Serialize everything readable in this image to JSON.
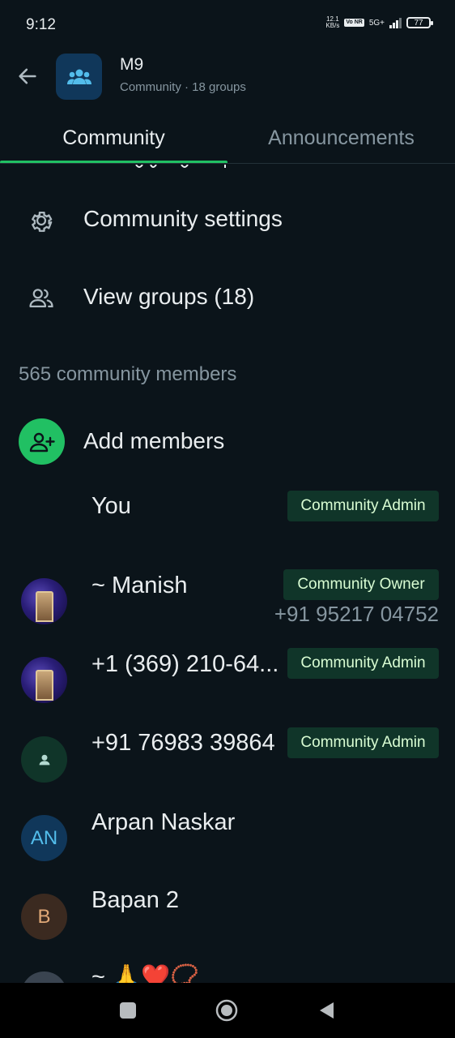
{
  "status_bar": {
    "time": "9:12",
    "net_speed": "12.1",
    "net_unit": "KB/s",
    "volte": "Vo NR",
    "network": "5G+",
    "battery": "77"
  },
  "header": {
    "title": "M9",
    "subtitle": "Community · 18 groups"
  },
  "tabs": [
    {
      "label": "Community",
      "active": true
    },
    {
      "label": "Announcements",
      "active": false
    }
  ],
  "menu": {
    "settings_label": "Community settings",
    "view_groups_label": "View groups (18)"
  },
  "members": {
    "count_label": "565 community members",
    "add_label": "Add members",
    "list": [
      {
        "name": "You",
        "badge": "Community Admin",
        "avatar": "none"
      },
      {
        "name": "~ Manish",
        "badge": "Community Owner",
        "phone": "+91 95217 04752",
        "avatar": "photo"
      },
      {
        "name": "+1 (369) 210-64...",
        "badge": "Community Admin",
        "avatar": "photo"
      },
      {
        "name": "+91 76983 39864",
        "badge": "Community Admin",
        "avatar": "default"
      },
      {
        "name": "Arpan Naskar",
        "initials": "AN",
        "avatar": "initials"
      },
      {
        "name": "Bapan 2",
        "initials": "B",
        "avatar": "initials"
      },
      {
        "name": "~ 🙏❤️📿",
        "avatar": "photo"
      }
    ]
  },
  "colors": {
    "background": "#0b141a",
    "accent": "#21c063",
    "badge_bg": "#103529",
    "muted_text": "#8696a0"
  },
  "icons": {
    "back": "arrow-left-icon",
    "community": "people-group-icon",
    "settings": "gear-icon",
    "groups": "people-outline-icon",
    "add": "person-add-icon"
  }
}
